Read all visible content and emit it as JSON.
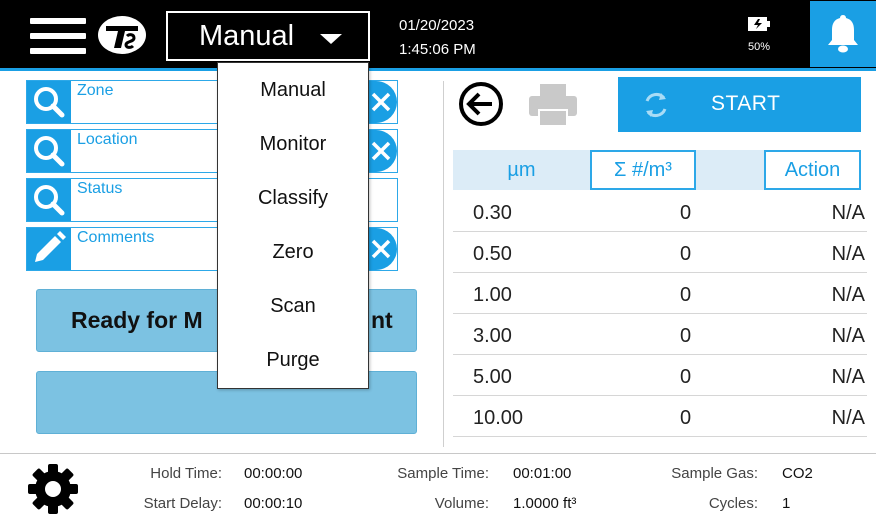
{
  "header": {
    "menu_icon": "hamburger-menu-icon",
    "logo_text": "TSI",
    "mode": "Manual",
    "date": "01/20/2023",
    "time": "1:45:06 PM",
    "battery_percent": "50%",
    "bell_icon": "bell-icon",
    "accent_color": "#1a9fe4"
  },
  "mode_menu": {
    "items": [
      {
        "label": "Manual"
      },
      {
        "label": "Monitor"
      },
      {
        "label": "Classify"
      },
      {
        "label": "Zero"
      },
      {
        "label": "Scan"
      },
      {
        "label": "Purge"
      }
    ]
  },
  "fields": [
    {
      "label": "Zone",
      "icon": "search-icon",
      "clear_icon": "close-icon"
    },
    {
      "label": "Location",
      "icon": "search-icon",
      "clear_icon": "close-icon"
    },
    {
      "label": "Status",
      "icon": "search-icon"
    },
    {
      "label": "Comments",
      "icon": "pencil-icon",
      "clear_icon": "close-icon"
    }
  ],
  "status": {
    "message_visible_left": "Ready for M",
    "message_visible_right": "nt"
  },
  "toolbar": {
    "back_icon": "back-arrow-icon",
    "print_icon": "printer-icon",
    "start_label": "START",
    "start_icon": "refresh-icon"
  },
  "table": {
    "headers": {
      "size": "µm",
      "sum": "Σ #/m³",
      "action": "Action"
    },
    "rows": [
      {
        "size": "0.30",
        "count": "0",
        "action": "N/A"
      },
      {
        "size": "0.50",
        "count": "0",
        "action": "N/A"
      },
      {
        "size": "1.00",
        "count": "0",
        "action": "N/A"
      },
      {
        "size": "3.00",
        "count": "0",
        "action": "N/A"
      },
      {
        "size": "5.00",
        "count": "0",
        "action": "N/A"
      },
      {
        "size": "10.00",
        "count": "0",
        "action": "N/A"
      }
    ]
  },
  "footer": {
    "settings_icon": "gear-icon",
    "hold_time_label": "Hold Time:",
    "hold_time_value": "00:00:00",
    "start_delay_label": "Start Delay:",
    "start_delay_value": "00:00:10",
    "sample_time_label": "Sample Time:",
    "sample_time_value": "00:01:00",
    "volume_label": "Volume:",
    "volume_value": "1.0000 ft³",
    "sample_gas_label": "Sample Gas:",
    "sample_gas_value": "CO2",
    "cycles_label": "Cycles:",
    "cycles_value": "1"
  }
}
